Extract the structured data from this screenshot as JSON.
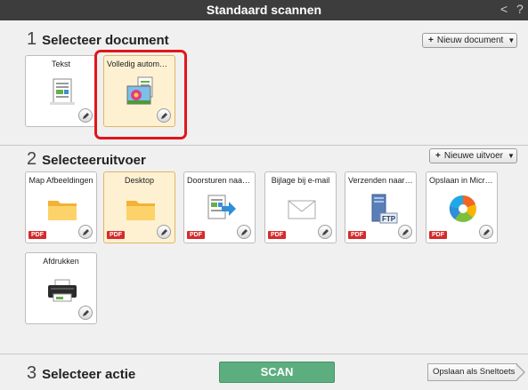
{
  "window": {
    "title": "Standaard scannen",
    "back_glyph": "<",
    "help_glyph": "?"
  },
  "section1": {
    "number": "1",
    "title": "Selecteer document",
    "new_button": "Nieuw document",
    "tiles": [
      {
        "label": "Tekst",
        "icon": "text-document-icon"
      },
      {
        "label": "Volledig automatis...",
        "icon": "photo-document-icon",
        "selected": true
      }
    ]
  },
  "section2": {
    "number": "2",
    "title": "Selecteeruitvoer",
    "new_button": "Nieuwe uitvoer",
    "pdf_badge": "PDF",
    "tiles": [
      {
        "label": "Map Afbeeldingen",
        "icon": "folder-icon"
      },
      {
        "label": "Desktop",
        "icon": "folder-icon",
        "selected": true
      },
      {
        "label": "Doorsturen naar t...",
        "icon": "forward-document-icon"
      },
      {
        "label": "Bijlage bij e-mail",
        "icon": "envelope-icon"
      },
      {
        "label": "Verzenden naar FT...",
        "icon": "ftp-server-icon",
        "badge": "FTP"
      },
      {
        "label": "Opslaan in Micros...",
        "icon": "office-logo-icon"
      },
      {
        "label": "Afdrukken",
        "icon": "printer-icon"
      }
    ]
  },
  "section3": {
    "number": "3",
    "title": "Selecteer actie",
    "scan_button": "SCAN",
    "save_shortcut_button": "Opslaan als Sneltoets"
  },
  "colors": {
    "titlebar": "#3d3d3d",
    "scan": "#5cae7e",
    "selected_tile": "#fdf1d2",
    "highlight": "#e0161c",
    "pdf": "#d62b2b"
  }
}
